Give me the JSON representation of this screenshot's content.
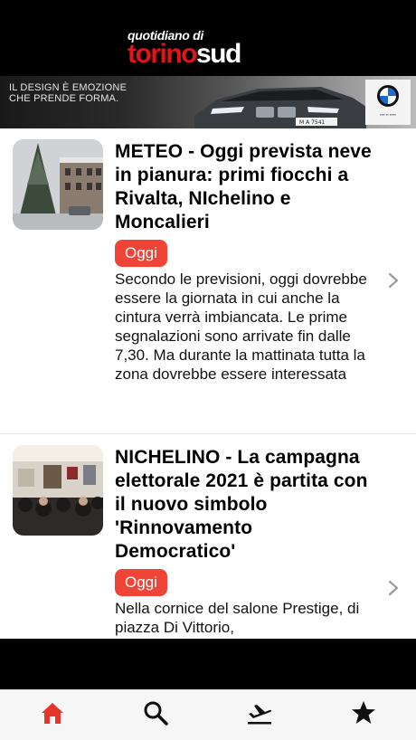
{
  "header": {
    "logo_top": "quotidiano di",
    "logo_red": "torino",
    "logo_white": "sud"
  },
  "banner": {
    "text": "IL DESIGN È EMOZIONE\nCHE PRENDE FORMA.",
    "car_plate": "M A 7541",
    "brand_icon": "bmw-logo-icon"
  },
  "articles": [
    {
      "title": "METEO - Oggi prevista neve in pianura: primi fiocchi a Rivalta, NIchelino e Moncalieri",
      "badge": "Oggi",
      "summary": "Secondo le previsioni, oggi dovrebbe essere la giornata in cui anche la cintura verrà imbiancata. Le prime segnalazioni sono arrivate fin dalle 7,30. Ma durante la mattinata tutta la zona dovrebbe essere interessata"
    },
    {
      "title": "NICHELINO - La campagna elettorale 2021 è partita con il nuovo simbolo 'Rinnovamento Democratico'",
      "badge": "Oggi",
      "summary": "Nella cornice del salone Prestige, di piazza Di Vittorio,"
    }
  ],
  "tabbar": {
    "active_color": "#e8352a",
    "inactive_color": "#111111",
    "items": [
      {
        "icon": "home-icon",
        "active": true
      },
      {
        "icon": "search-icon",
        "active": false
      },
      {
        "icon": "plane-departure-icon",
        "active": false
      },
      {
        "icon": "star-icon",
        "active": false
      }
    ]
  }
}
